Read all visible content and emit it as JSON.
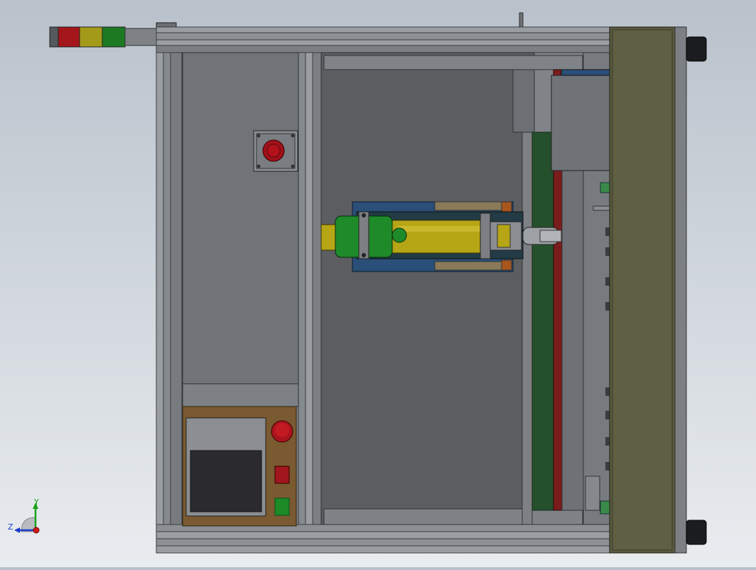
{
  "view": {
    "background_top": "#b9c2cc",
    "background_bottom": "#e9ecef"
  },
  "triad": {
    "y_label": "Y",
    "z_label": "Z",
    "y_color": "#1aa31a",
    "z_color": "#1a3ccc",
    "x_color": "#d01a1a"
  },
  "colors": {
    "frame": "#8e9297",
    "frame_dark": "#4a4d51",
    "panel_gray": "#6f7276",
    "inner_gray": "#56585b",
    "right_panel": "#5a5a40",
    "control_box": "#7a5a30",
    "screen": "#2b2b2d",
    "estop_red": "#b3121b",
    "cylinder_green": "#1f8a2a",
    "cylinder_yellow": "#b6a515",
    "base_blue": "#2a4f78",
    "rail_green": "#24502c",
    "rail_red": "#7a1c1c",
    "lamp_red": "#a4161c",
    "lamp_yellow": "#a49a1a",
    "lamp_green": "#1d7a22"
  }
}
